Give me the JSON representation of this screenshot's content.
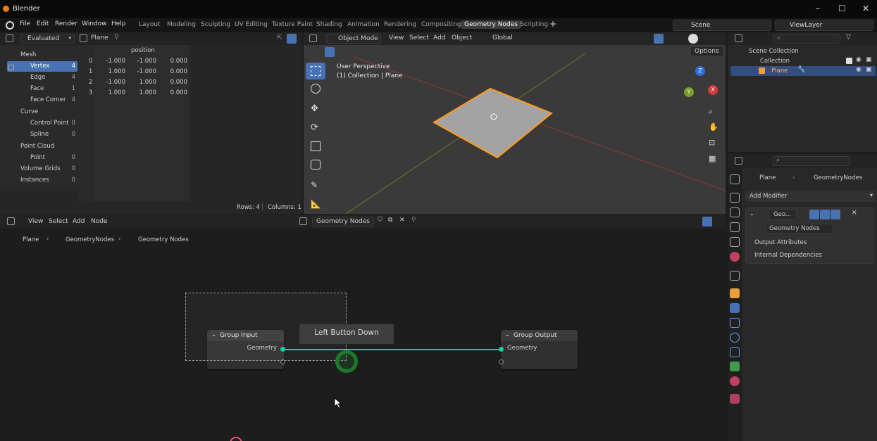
{
  "app": {
    "title": "Blender"
  },
  "menubar": {
    "menus": [
      "File",
      "Edit",
      "Render",
      "Window",
      "Help"
    ],
    "workspaces": [
      "Layout",
      "Modeling",
      "Sculpting",
      "UV Editing",
      "Texture Paint",
      "Shading",
      "Animation",
      "Rendering",
      "Compositing",
      "Geometry Nodes",
      "Scripting"
    ],
    "active_workspace": "Geometry Nodes",
    "scene": "Scene",
    "view_layer": "ViewLayer"
  },
  "spreadsheet": {
    "mode": "Evaluated",
    "object": "Plane",
    "column_header": "position",
    "sidebar": [
      {
        "label": "Mesh",
        "count": "",
        "level": 0,
        "selected": false
      },
      {
        "label": "Vertex",
        "count": "4",
        "level": 1,
        "selected": true
      },
      {
        "label": "Edge",
        "count": "4",
        "level": 1,
        "selected": false
      },
      {
        "label": "Face",
        "count": "1",
        "level": 1,
        "selected": false
      },
      {
        "label": "Face Corner",
        "count": "4",
        "level": 1,
        "selected": false
      },
      {
        "label": "Curve",
        "count": "",
        "level": 0,
        "selected": false
      },
      {
        "label": "Control Point",
        "count": "0",
        "level": 1,
        "selected": false
      },
      {
        "label": "Spline",
        "count": "0",
        "level": 1,
        "selected": false
      },
      {
        "label": "Point Cloud",
        "count": "",
        "level": 0,
        "selected": false
      },
      {
        "label": "Point",
        "count": "0",
        "level": 1,
        "selected": false
      },
      {
        "label": "Volume Grids",
        "count": "0",
        "level": 0,
        "selected": false
      },
      {
        "label": "Instances",
        "count": "0",
        "level": 0,
        "selected": false
      }
    ],
    "rows": [
      {
        "index": "0",
        "x": "-1.000",
        "y": "-1.000",
        "z": "0.000"
      },
      {
        "index": "1",
        "x": "1.000",
        "y": "-1.000",
        "z": "0.000"
      },
      {
        "index": "2",
        "x": "-1.000",
        "y": "1.000",
        "z": "0.000"
      },
      {
        "index": "3",
        "x": "1.000",
        "y": "1.000",
        "z": "0.000"
      }
    ],
    "footer_rows": "Rows: 4",
    "footer_columns": "Columns: 1"
  },
  "viewport": {
    "mode": "Object Mode",
    "menus": [
      "View",
      "Select",
      "Add",
      "Object"
    ],
    "transform": "Global",
    "options": "Options",
    "info_line1": "User Perspective",
    "info_line2": "(1) Collection | Plane",
    "gizmo_axes": [
      "Z",
      "X",
      "Y"
    ]
  },
  "outliner": {
    "items": [
      {
        "label": "Scene Collection",
        "indent": 0,
        "selected": false
      },
      {
        "label": "Collection",
        "indent": 1,
        "selected": false
      },
      {
        "label": "Plane",
        "indent": 2,
        "selected": true
      }
    ]
  },
  "properties": {
    "breadcrumb_object": "Plane",
    "breadcrumb_modifier": "GeometryNodes",
    "add_modifier": "Add Modifier",
    "modifier_name": "Geo...",
    "node_group": "Geometry Nodes",
    "sections": [
      "Output Attributes",
      "Internal Dependencies"
    ]
  },
  "node_editor": {
    "menus": [
      "View",
      "Select",
      "Add",
      "Node"
    ],
    "node_tree": "Geometry Nodes",
    "breadcrumb": [
      "Plane",
      "GeometryNodes",
      "Geometry Nodes"
    ],
    "tooltip": "Left Button Down",
    "group_input": {
      "title": "Group Input",
      "socket": "Geometry"
    },
    "group_output": {
      "title": "Group Output",
      "socket": "Geometry"
    }
  },
  "colors": {
    "accent": "#4772b3",
    "socket_geometry": "#00d6a3",
    "selection_outline": "#ff9a1f"
  }
}
